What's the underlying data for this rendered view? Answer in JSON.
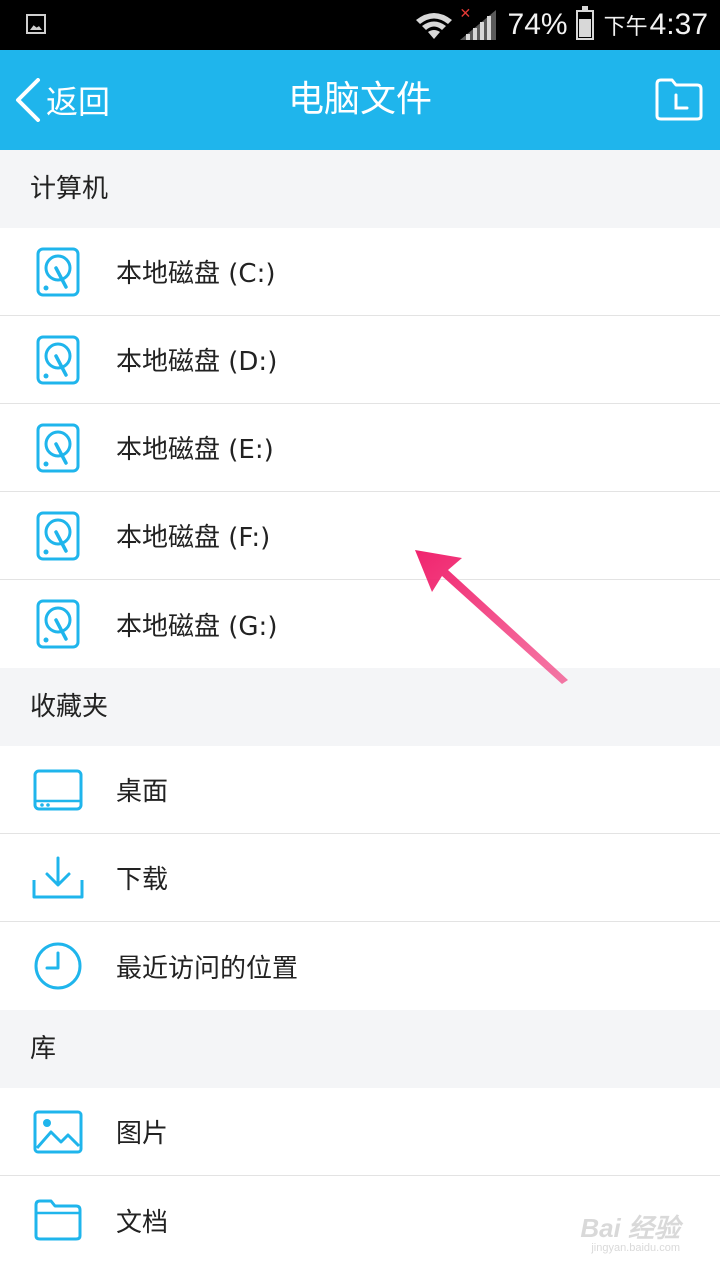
{
  "status_bar": {
    "battery_percent": "74%",
    "time_prefix": "下午",
    "time": "4:37"
  },
  "header": {
    "back_label": "返回",
    "title": "电脑文件"
  },
  "sections": {
    "computer": {
      "title": "计算机",
      "items": [
        {
          "label": "本地磁盘 (C:)",
          "icon": "disk-icon"
        },
        {
          "label": "本地磁盘 (D:)",
          "icon": "disk-icon"
        },
        {
          "label": "本地磁盘 (E:)",
          "icon": "disk-icon"
        },
        {
          "label": "本地磁盘 (F:)",
          "icon": "disk-icon"
        },
        {
          "label": "本地磁盘 (G:)",
          "icon": "disk-icon"
        }
      ]
    },
    "favorites": {
      "title": "收藏夹",
      "items": [
        {
          "label": "桌面",
          "icon": "desktop-icon"
        },
        {
          "label": "下载",
          "icon": "download-icon"
        },
        {
          "label": "最近访问的位置",
          "icon": "clock-icon"
        }
      ]
    },
    "library": {
      "title": "库",
      "items": [
        {
          "label": "图片",
          "icon": "image-icon"
        },
        {
          "label": "文档",
          "icon": "folder-icon"
        }
      ]
    }
  },
  "colors": {
    "accent": "#1fb5ec",
    "arrow": "#f0246e"
  },
  "watermark": {
    "text": "Bai 经验",
    "sub": "jingyan.baidu.com"
  }
}
